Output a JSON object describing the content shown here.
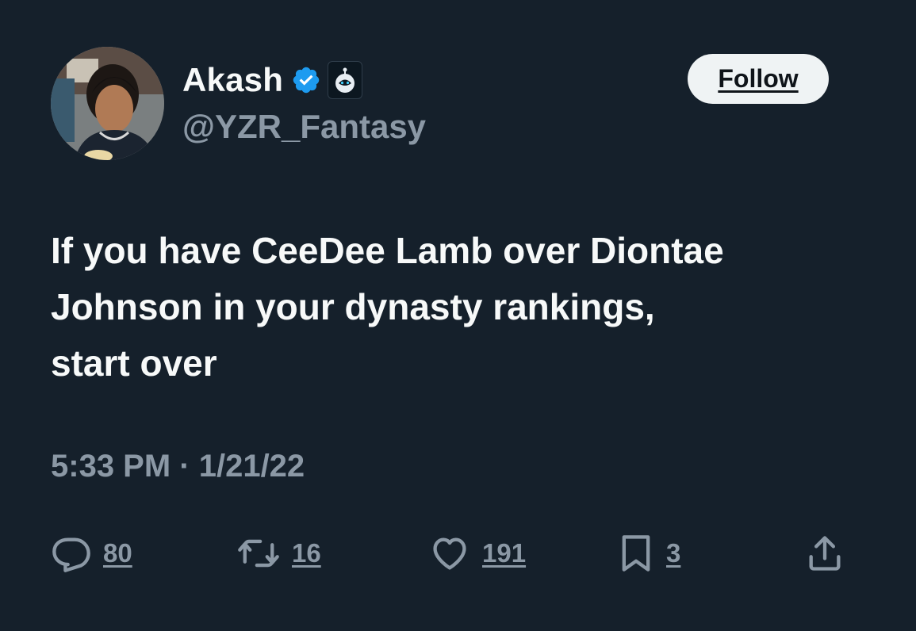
{
  "author": {
    "display_name": "Akash",
    "handle": "@YZR_Fantasy",
    "verified_icon": "verified-badge-icon",
    "affiliation_icon": "robot-affiliate-icon"
  },
  "follow_label": "Follow",
  "tweet": {
    "text_lines": [
      "If you have CeeDee Lamb over Diontae",
      "Johnson in your dynasty rankings,",
      "start over"
    ],
    "timestamp": "5:33 PM · 1/21/22"
  },
  "actions": {
    "reply": {
      "icon": "reply-icon",
      "count": "80"
    },
    "retweet": {
      "icon": "retweet-icon",
      "count": "16"
    },
    "like": {
      "icon": "heart-icon",
      "count": "191"
    },
    "bookmark": {
      "icon": "bookmark-icon",
      "count": "3"
    },
    "share": {
      "icon": "share-icon"
    }
  },
  "colors": {
    "background": "#15202b",
    "text": "#f7f9f9",
    "secondary_text": "#8b98a5",
    "verified": "#1d9bf0",
    "follow_button_bg": "#eff3f4"
  }
}
